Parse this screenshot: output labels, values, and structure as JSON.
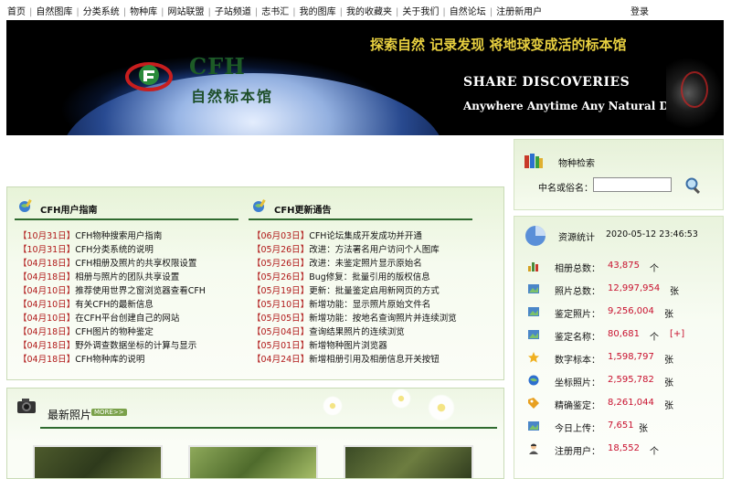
{
  "nav": {
    "items": [
      "首页",
      "自然图库",
      "分类系统",
      "物种库",
      "网站联盟",
      "子站频道",
      "志书汇",
      "我的图库",
      "我的收藏夹",
      "关于我们",
      "自然论坛",
      "注册新用户"
    ],
    "login": "登录"
  },
  "banner": {
    "brand": "CFH",
    "subtitle": "自然标本馆",
    "slogan": "探索自然 记录发现   将地球变成活的标本馆",
    "tagline1": "SHARE DISCOVERIES",
    "tagline2": "Anywhere Anytime Any Natural Diversity"
  },
  "guide": {
    "title": "CFH用户指南",
    "items": [
      {
        "date": "【10月31日】",
        "text": "CFH物种搜索用户指南"
      },
      {
        "date": "【10月31日】",
        "text": "CFH分类系统的说明"
      },
      {
        "date": "【04月18日】",
        "text": "CFH相册及照片的共享权限设置"
      },
      {
        "date": "【04月18日】",
        "text": "相册与照片的团队共享设置"
      },
      {
        "date": "【04月10日】",
        "text": "推荐使用世界之窗浏览器查看CFH"
      },
      {
        "date": "【04月10日】",
        "text": "有关CFH的最新信息"
      },
      {
        "date": "【04月10日】",
        "text": "在CFH平台创建自己的网站"
      },
      {
        "date": "【04月18日】",
        "text": "CFH图片的物种鉴定"
      },
      {
        "date": "【04月18日】",
        "text": "野外调查数据坐标的计算与显示"
      },
      {
        "date": "【04月18日】",
        "text": "CFH物种库的说明"
      }
    ]
  },
  "news": {
    "title": "CFH更新通告",
    "items": [
      {
        "date": "【06月03日】",
        "text": "CFH论坛集成开发成功并开通"
      },
      {
        "date": "【05月26日】",
        "text": "改进：方法署名用户访问个人图库"
      },
      {
        "date": "【05月26日】",
        "text": "改进：未鉴定照片显示原始名"
      },
      {
        "date": "【05月26日】",
        "text": "Bug修复：批量引用的版权信息"
      },
      {
        "date": "【05月19日】",
        "text": "更新：批量鉴定启用新网页的方式"
      },
      {
        "date": "【05月10日】",
        "text": "新增功能：显示照片原始文件名"
      },
      {
        "date": "【05月05日】",
        "text": "新增功能：按地名查询照片并连续浏览"
      },
      {
        "date": "【05月04日】",
        "text": "查询结果照片的连续浏览"
      },
      {
        "date": "【05月01日】",
        "text": "新增物种图片浏览器"
      },
      {
        "date": "【04月24日】",
        "text": "新增相册引用及相册信息开关按钮"
      }
    ]
  },
  "photos": {
    "title": "最新照片",
    "more": "MORE>>"
  },
  "search": {
    "title": "物种检索",
    "label": "中名或俗名：",
    "value": "",
    "placeholder": ""
  },
  "stats": {
    "title": "资源统计",
    "date": "2020-05-12 23:46:53",
    "rows": [
      {
        "icon": "bar-chart-icon",
        "label": "相册总数：",
        "value": "43,875",
        "unit": "个",
        "extra": ""
      },
      {
        "icon": "photo-icon",
        "label": "照片总数：",
        "value": "12,997,954",
        "unit": "张",
        "extra": ""
      },
      {
        "icon": "photo-icon",
        "label": "鉴定照片：",
        "value": "9,256,004",
        "unit": "张",
        "extra": ""
      },
      {
        "icon": "photo-icon",
        "label": "鉴定名称：",
        "value": "80,681",
        "unit": "个",
        "extra": "[+]"
      },
      {
        "icon": "star-icon",
        "label": "数字标本：",
        "value": "1,598,797",
        "unit": "张",
        "extra": ""
      },
      {
        "icon": "globe-icon",
        "label": "坐标照片：",
        "value": "2,595,782",
        "unit": "张",
        "extra": ""
      },
      {
        "icon": "tag-icon",
        "label": "精确鉴定：",
        "value": "8,261,044",
        "unit": "张",
        "extra": ""
      },
      {
        "icon": "photo-icon",
        "label": "今日上传：",
        "value": "7,651",
        "unit": "张",
        "extra": ""
      },
      {
        "icon": "user-icon",
        "label": "注册用户：",
        "value": "18,552",
        "unit": "个",
        "extra": ""
      }
    ]
  },
  "colors": {
    "accent_green": "#2f6b2f",
    "date_red": "#b01818",
    "value_red": "#c8102e",
    "slogan_yellow": "#e8d040"
  }
}
